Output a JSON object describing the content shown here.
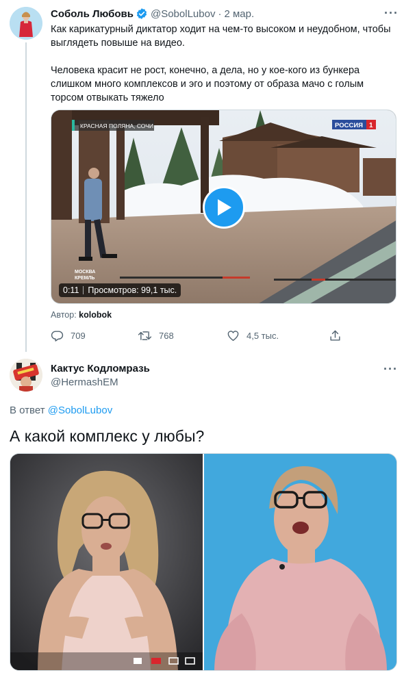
{
  "tweet1": {
    "name": "Соболь Любовь",
    "handle": "@SobolLubov",
    "date": "2 мар.",
    "text_p1": "Как карикатурный диктатор ходит на чем-то высоком и неудобном, чтобы выглядеть повыше на видео.",
    "text_p2": "Человека красит не рост, конечно, а дела, но у кое-кого из бункера слишком много комплексов и эго и поэтому от образа мачо с голым торсом отвыкать тяжело",
    "video": {
      "location_caption": "КРАСНАЯ ПОЛЯНА, СОЧИ",
      "channel_logo": "РОССИЯ",
      "channel_number": "1",
      "corner_caption_1": "МОСКВА",
      "corner_caption_2": "КРЕМЛЬ",
      "duration": "0:11",
      "views": "Просмотров: 99,1 тыс."
    },
    "author_label": "Автор:",
    "author_name": "kolobok",
    "replies": "709",
    "retweets": "768",
    "likes": "4,5 тыс."
  },
  "tweet2": {
    "name": "Кактус Кодломразь",
    "handle": "@HermashEM",
    "reply_prefix": "В ответ",
    "reply_to": "@SobolLubov",
    "text": "А какой комплекс у любы?"
  },
  "colors": {
    "accent": "#1d9bf0",
    "text_primary": "#0f1419",
    "text_secondary": "#536471",
    "border": "#cfd9de",
    "russia1_red": "#d8262c",
    "russia1_blue": "#2a4d9c"
  },
  "icons": {
    "verified": "verified-badge-icon",
    "more": "more-dots-icon",
    "reply": "reply-bubble-icon",
    "retweet": "retweet-icon",
    "like": "heart-icon",
    "share": "share-icon",
    "play": "play-icon"
  }
}
